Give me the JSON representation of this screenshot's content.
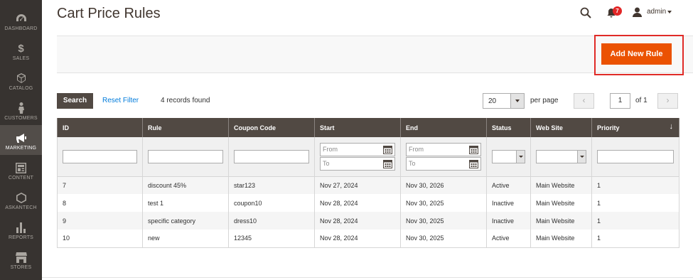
{
  "sidebar": {
    "items": [
      {
        "label": "DASHBOARD",
        "icon": "dashboard-icon"
      },
      {
        "label": "SALES",
        "icon": "dollar-icon"
      },
      {
        "label": "CATALOG",
        "icon": "cube-icon"
      },
      {
        "label": "CUSTOMERS",
        "icon": "person-icon"
      },
      {
        "label": "MARKETING",
        "icon": "megaphone-icon",
        "active": true
      },
      {
        "label": "CONTENT",
        "icon": "content-icon"
      },
      {
        "label": "ASKANTECH",
        "icon": "hexagon-icon"
      },
      {
        "label": "REPORTS",
        "icon": "bar-chart-icon"
      },
      {
        "label": "STORES",
        "icon": "store-icon"
      }
    ]
  },
  "header": {
    "title": "Cart Price Rules",
    "notification_count": "7",
    "user_name": "admin"
  },
  "actions": {
    "add_new_rule": "Add New Rule"
  },
  "toolbar": {
    "search_label": "Search",
    "reset_label": "Reset Filter",
    "records_found": "4 records found",
    "per_page_value": "20",
    "per_page_label": "per page",
    "current_page": "1",
    "of_pages": "of 1",
    "prev": "‹",
    "next": "›"
  },
  "grid": {
    "columns": [
      "ID",
      "Rule",
      "Coupon Code",
      "Start",
      "End",
      "Status",
      "Web Site",
      "Priority"
    ],
    "sort_indicator": "↓",
    "filters": {
      "from_placeholder": "From",
      "to_placeholder": "To"
    },
    "rows": [
      {
        "id": "7",
        "rule": "discount 45%",
        "coupon": "star123",
        "start": "Nov 27, 2024",
        "end": "Nov 30, 2026",
        "status": "Active",
        "website": "Main Website",
        "priority": "1"
      },
      {
        "id": "8",
        "rule": "test 1",
        "coupon": "coupon10",
        "start": "Nov 28, 2024",
        "end": "Nov 30, 2025",
        "status": "Inactive",
        "website": "Main Website",
        "priority": "1"
      },
      {
        "id": "9",
        "rule": "specific category",
        "coupon": "dress10",
        "start": "Nov 28, 2024",
        "end": "Nov 30, 2025",
        "status": "Inactive",
        "website": "Main Website",
        "priority": "1"
      },
      {
        "id": "10",
        "rule": "new",
        "coupon": "12345",
        "start": "Nov 28, 2024",
        "end": "Nov 30, 2025",
        "status": "Active",
        "website": "Main Website",
        "priority": "1"
      }
    ]
  },
  "colors": {
    "accent": "#eb5202",
    "sidebar_bg": "#373330",
    "header_row_bg": "#514943",
    "highlight_border": "#e02b27",
    "link": "#007bdb"
  }
}
